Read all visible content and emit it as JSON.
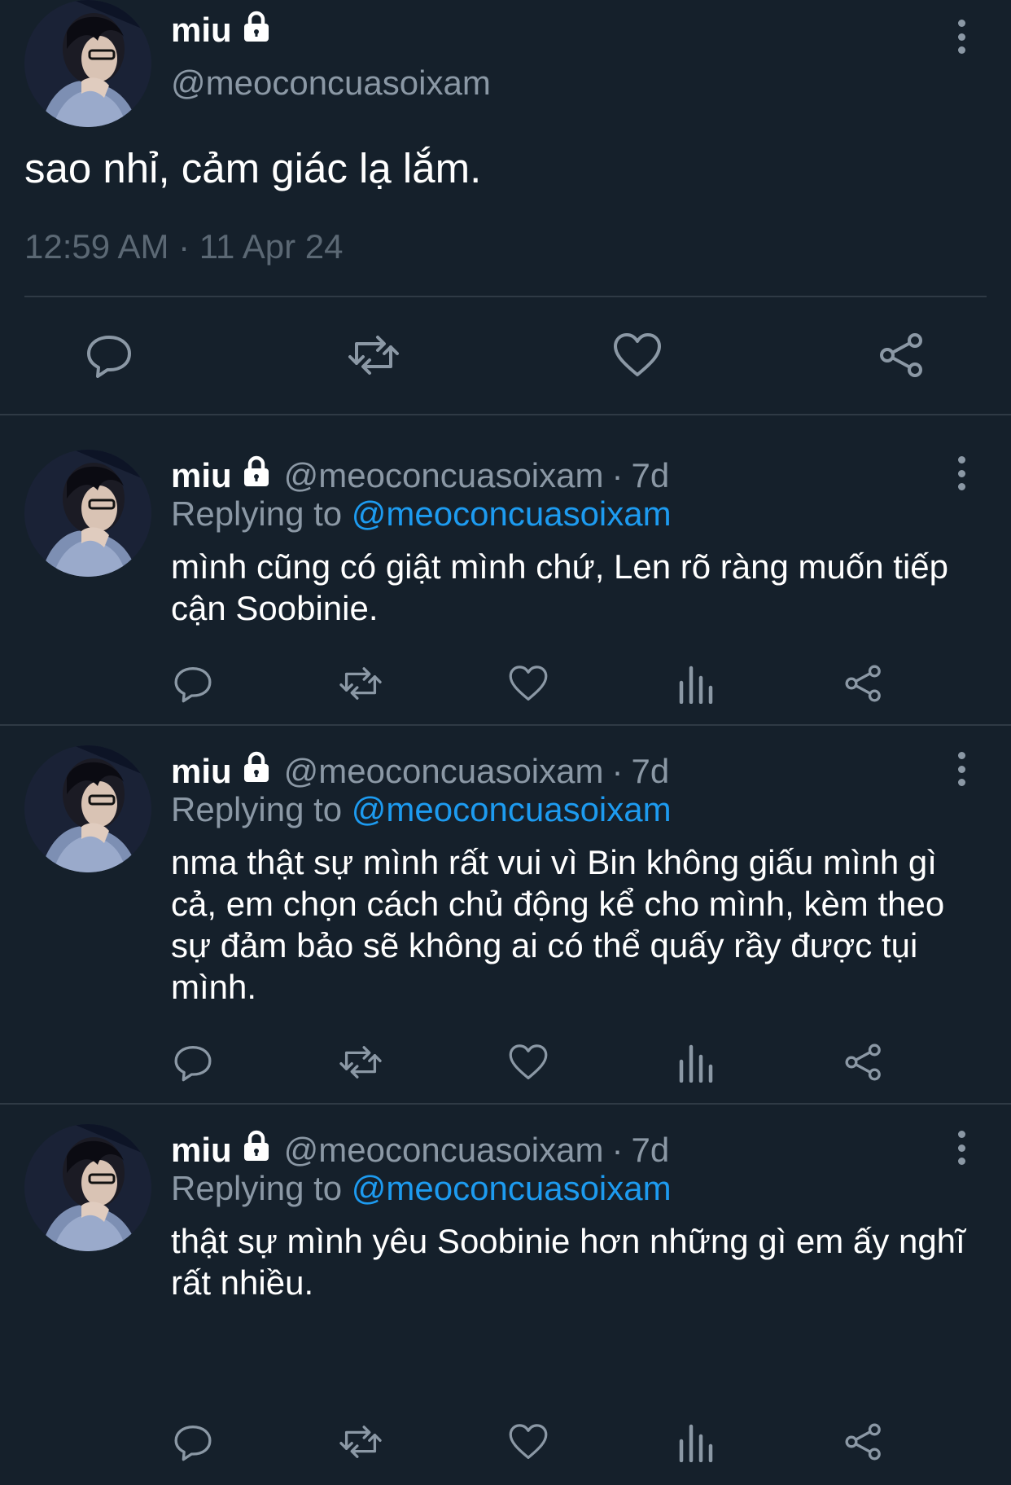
{
  "main_tweet": {
    "display_name": "miu",
    "handle": "@meoconcuasoixam",
    "text": "sao nhỉ, cảm giác lạ lắm.",
    "timestamp": "12:59 AM · 11 Apr 24",
    "actions": [
      "reply-icon",
      "retweet-icon",
      "like-icon",
      "share-icon"
    ]
  },
  "replies": [
    {
      "display_name": "miu",
      "handle": "@meoconcuasoixam",
      "separator": "·",
      "time": "7d",
      "replying_prefix": "Replying to ",
      "replying_to": "@meoconcuasoixam",
      "text": "mình cũng có giật mình chứ, Len rõ ràng muốn tiếp cận Soobinie."
    },
    {
      "display_name": "miu",
      "handle": "@meoconcuasoixam",
      "separator": "·",
      "time": "7d",
      "replying_prefix": "Replying to ",
      "replying_to": "@meoconcuasoixam",
      "text": "nma thật sự mình rất vui vì Bin không giấu mình gì cả, em chọn cách chủ động kể cho mình, kèm theo sự đảm bảo sẽ không ai có thể quấy rầy được tụi mình."
    },
    {
      "display_name": "miu",
      "handle": "@meoconcuasoixam",
      "separator": "·",
      "time": "7d",
      "replying_prefix": "Replying to ",
      "replying_to": "@meoconcuasoixam",
      "text": "thật sự mình yêu Soobinie hơn những gì em ấy nghĩ rất nhiều."
    }
  ],
  "colors": {
    "background": "#15202b",
    "text": "#ffffff",
    "secondary": "#8b98a5",
    "mention": "#1d9bf0",
    "divider": "#2f3a45"
  }
}
